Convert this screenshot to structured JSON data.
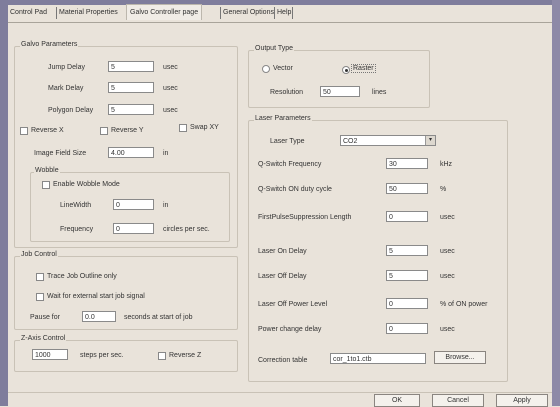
{
  "tabs": [
    {
      "label": "Control Pad"
    },
    {
      "label": "Material Properties"
    },
    {
      "label": "Galvo Controller page"
    },
    {
      "label": "General Options"
    },
    {
      "label": "Help"
    }
  ],
  "galvo": {
    "title": "Galvo Parameters",
    "jump_delay": {
      "label": "Jump Delay",
      "value": "5",
      "unit": "usec"
    },
    "mark_delay": {
      "label": "Mark Delay",
      "value": "5",
      "unit": "usec"
    },
    "polygon_delay": {
      "label": "Polygon Delay",
      "value": "5",
      "unit": "usec"
    },
    "reverse_x": "Reverse X",
    "reverse_y": "Reverse Y",
    "swap_xy": "Swap XY",
    "image_field": {
      "label": "Image Field Size",
      "value": "4.00",
      "unit": "in"
    },
    "wobble": {
      "title": "Wobble",
      "enable": "Enable Wobble Mode",
      "line_width": {
        "label": "LineWidth",
        "value": "0",
        "unit": "in"
      },
      "frequency": {
        "label": "Frequency",
        "value": "0",
        "unit": "circles per sec."
      }
    }
  },
  "job": {
    "title": "Job Control",
    "trace": "Trace Job Outline only",
    "wait": "Wait for external start job signal",
    "pause": {
      "label": "Pause for",
      "value": "0.0",
      "unit": "seconds at start of job"
    }
  },
  "zaxis": {
    "title": "Z-Axis Control",
    "value": "1000",
    "unit": "steps per sec.",
    "reverse": "Reverse Z"
  },
  "output": {
    "title": "Output Type",
    "vector": "Vector",
    "raster": "Raster",
    "resolution": {
      "label": "Resolution",
      "value": "50",
      "unit": "lines"
    }
  },
  "laser": {
    "title": "Laser Parameters",
    "type": {
      "label": "Laser Type",
      "value": "CO2"
    },
    "qswitch_freq": {
      "label": "Q-Switch Frequency",
      "value": "30",
      "unit": "kHz"
    },
    "qswitch_duty": {
      "label": "Q-Switch ON duty cycle",
      "value": "50",
      "unit": "%"
    },
    "first_pulse": {
      "label": "FirstPulseSuppression Length",
      "value": "0",
      "unit": "usec"
    },
    "laser_on": {
      "label": "Laser On Delay",
      "value": "5",
      "unit": "usec"
    },
    "laser_off": {
      "label": "Laser Off Delay",
      "value": "5",
      "unit": "usec"
    },
    "off_power": {
      "label": "Laser Off Power Level",
      "value": "0",
      "unit": "% of ON power"
    },
    "power_change": {
      "label": "Power change delay",
      "value": "0",
      "unit": "usec"
    },
    "correction": {
      "label": "Correction table",
      "value": "cor_1to1.ctb",
      "browse": "Browse..."
    }
  },
  "buttons": {
    "ok": "OK",
    "cancel": "Cancel",
    "apply": "Apply"
  }
}
